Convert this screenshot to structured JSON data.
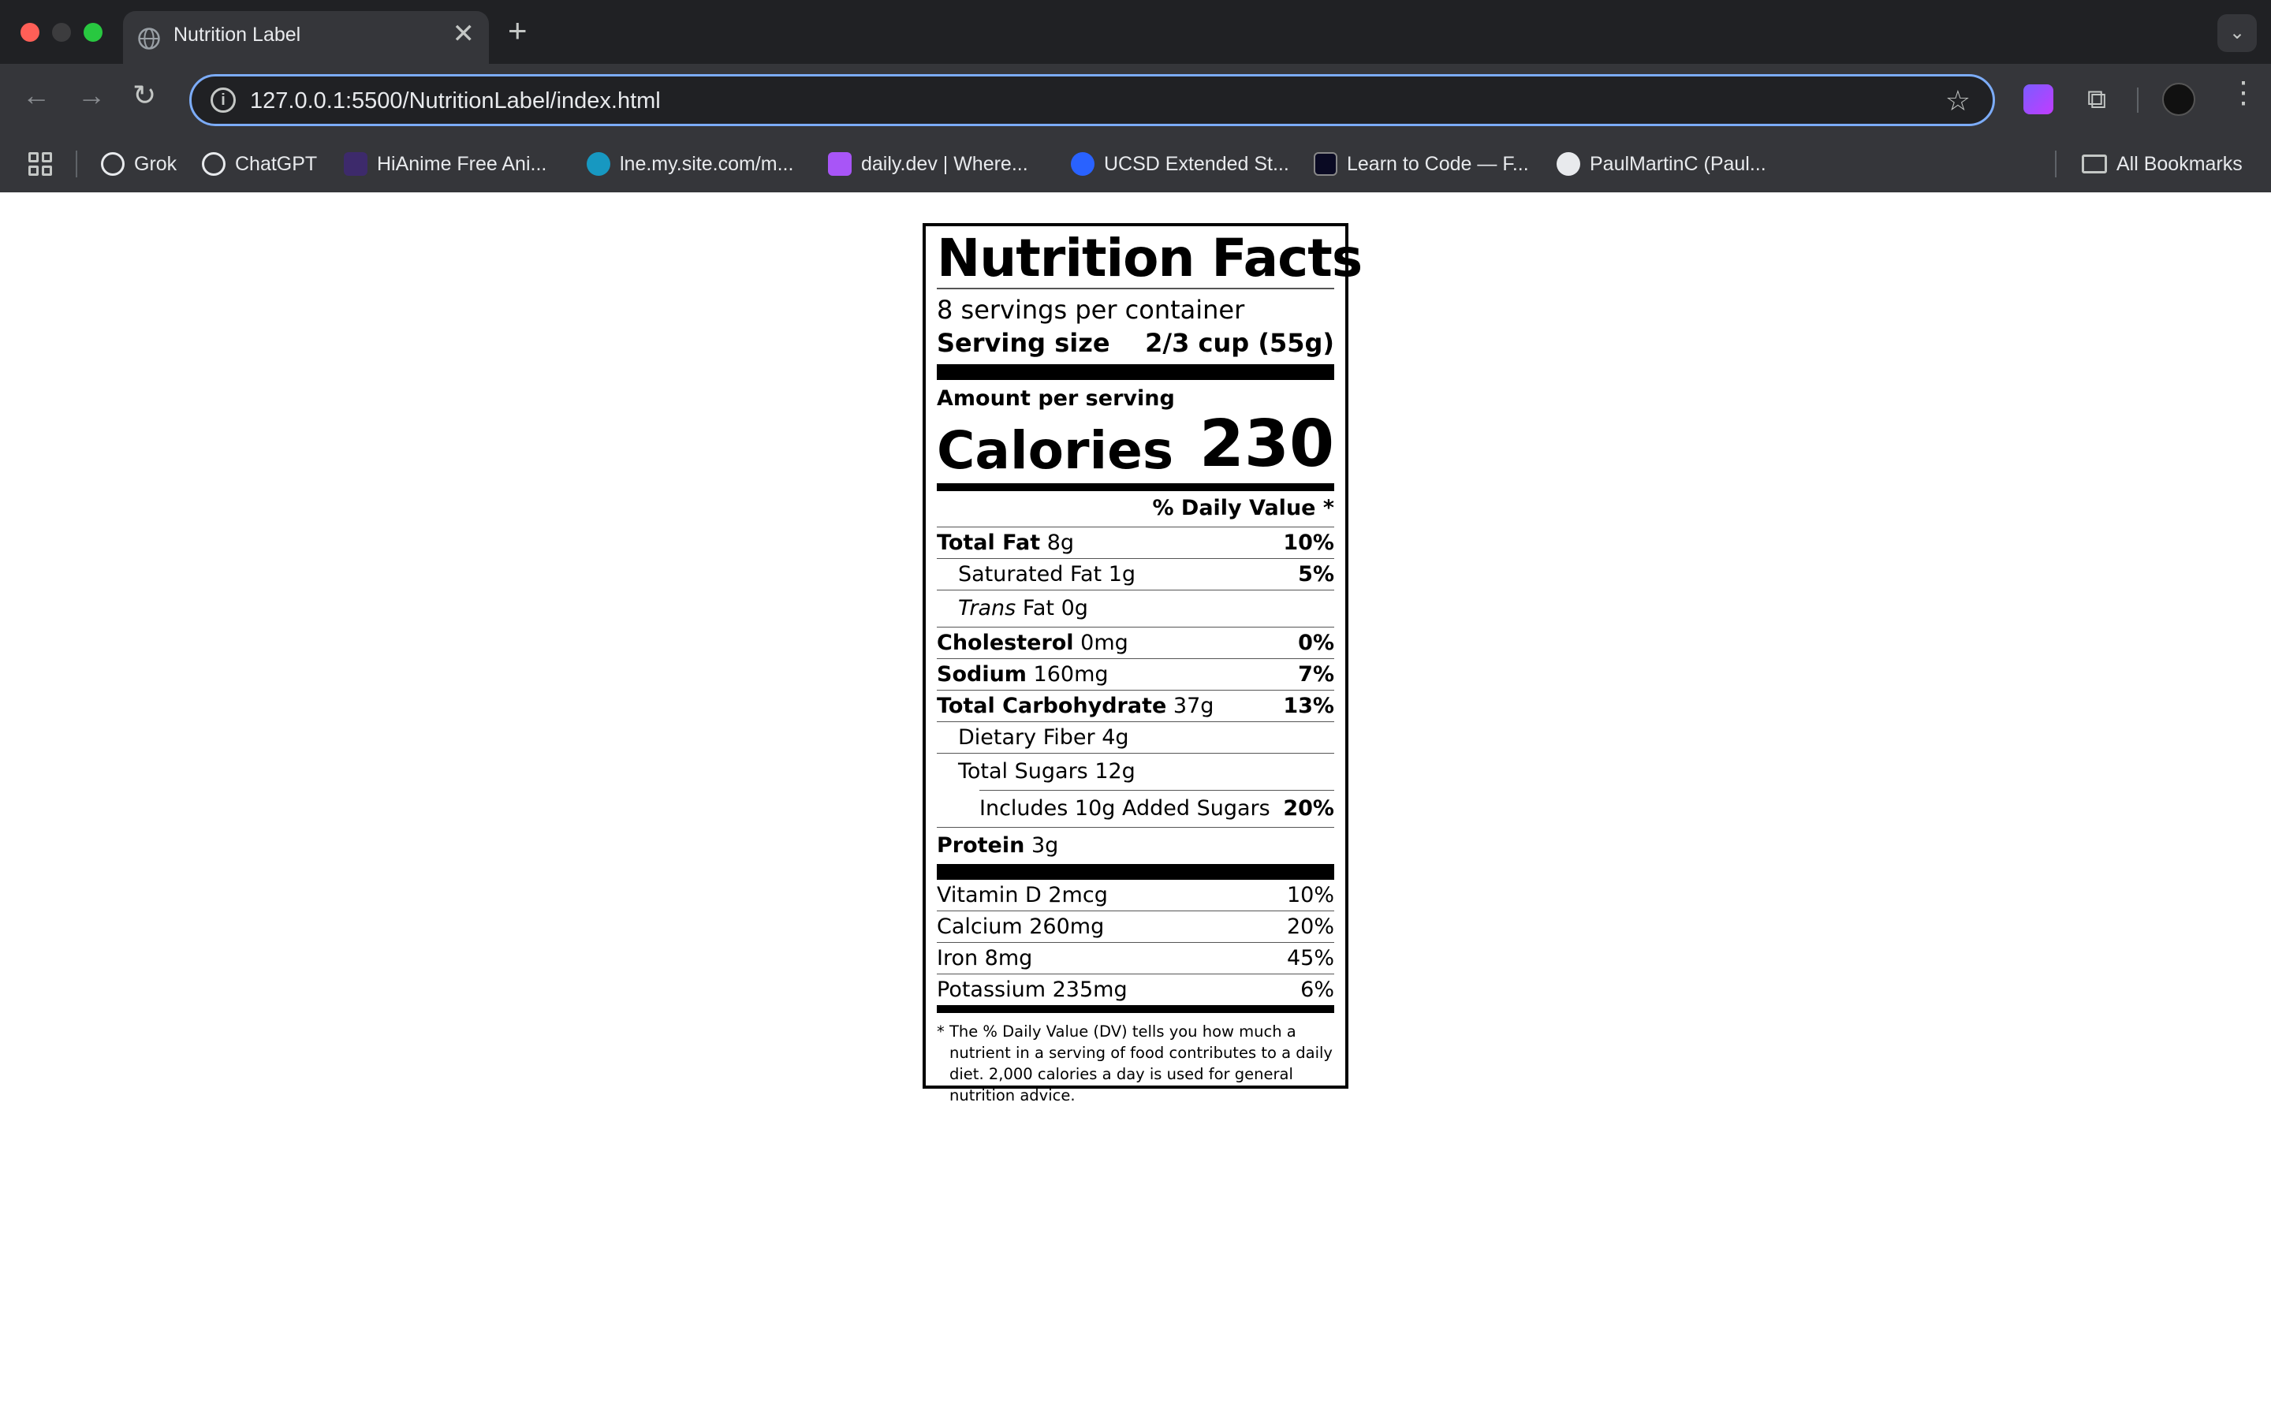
{
  "window": {
    "tab_title": "Nutrition Label",
    "url": "127.0.0.1:5500/NutritionLabel/index.html"
  },
  "icons": {
    "tab_close": "✕",
    "new_tab": "+",
    "tab_menu": "⌄",
    "back": "←",
    "forward": "→",
    "reload": "↻",
    "info": "i",
    "star": "☆",
    "puzzle": "⧉",
    "kebab": "⋮"
  },
  "bookmarks": {
    "items": [
      {
        "label": "Grok",
        "color": "#e8eaed"
      },
      {
        "label": "ChatGPT",
        "color": "#e8eaed"
      },
      {
        "label": "HiAnime Free Ani...",
        "color": "#3d2a6b"
      },
      {
        "label": "lne.my.site.com/m...",
        "color": "#1798c1"
      },
      {
        "label": "daily.dev | Where...",
        "color": "#a855f7"
      },
      {
        "label": "UCSD Extended St...",
        "color": "#2962ff"
      },
      {
        "label": "Learn to Code — F...",
        "color": "#0a0a23"
      },
      {
        "label": "PaulMartinC (Paul...",
        "color": "#e8eaed"
      }
    ],
    "all_bookmarks": "All Bookmarks"
  },
  "label": {
    "title": "Nutrition Facts",
    "servings": "8 servings per container",
    "serving_size_label": "Serving size",
    "serving_size_value": "2/3 cup (55g)",
    "amount_per_serving": "Amount per serving",
    "calories_label": "Calories",
    "calories_value": "230",
    "daily_value_header": "% Daily Value *",
    "nutrients": {
      "total_fat": {
        "name": "Total Fat",
        "amount": "8g",
        "pct": "10%"
      },
      "saturated_fat": {
        "name": "Saturated Fat 1g",
        "pct": "5%"
      },
      "trans_fat": {
        "name_italic": "Trans",
        "name_rest": "Fat 0g"
      },
      "cholesterol": {
        "name": "Cholesterol",
        "amount": "0mg",
        "pct": "0%"
      },
      "sodium": {
        "name": "Sodium",
        "amount": "160mg",
        "pct": "7%"
      },
      "total_carb": {
        "name": "Total Carbohydrate",
        "amount": "37g",
        "pct": "13%"
      },
      "fiber": {
        "name": "Dietary Fiber 4g"
      },
      "sugars": {
        "name": "Total Sugars 12g"
      },
      "added_sugars": {
        "name": "Includes 10g Added Sugars",
        "pct": "20%"
      },
      "protein": {
        "name": "Protein",
        "amount": "3g"
      }
    },
    "vitamins": [
      {
        "name": "Vitamin D 2mcg",
        "pct": "10%"
      },
      {
        "name": "Calcium 260mg",
        "pct": "20%"
      },
      {
        "name": "Iron 8mg",
        "pct": "45%"
      },
      {
        "name": "Potassium 235mg",
        "pct": "6%"
      }
    ],
    "footnote": "* The % Daily Value (DV) tells you how much a nutrient in a serving of food contributes to a daily diet. 2,000 calories a day is used for general nutrition advice."
  }
}
